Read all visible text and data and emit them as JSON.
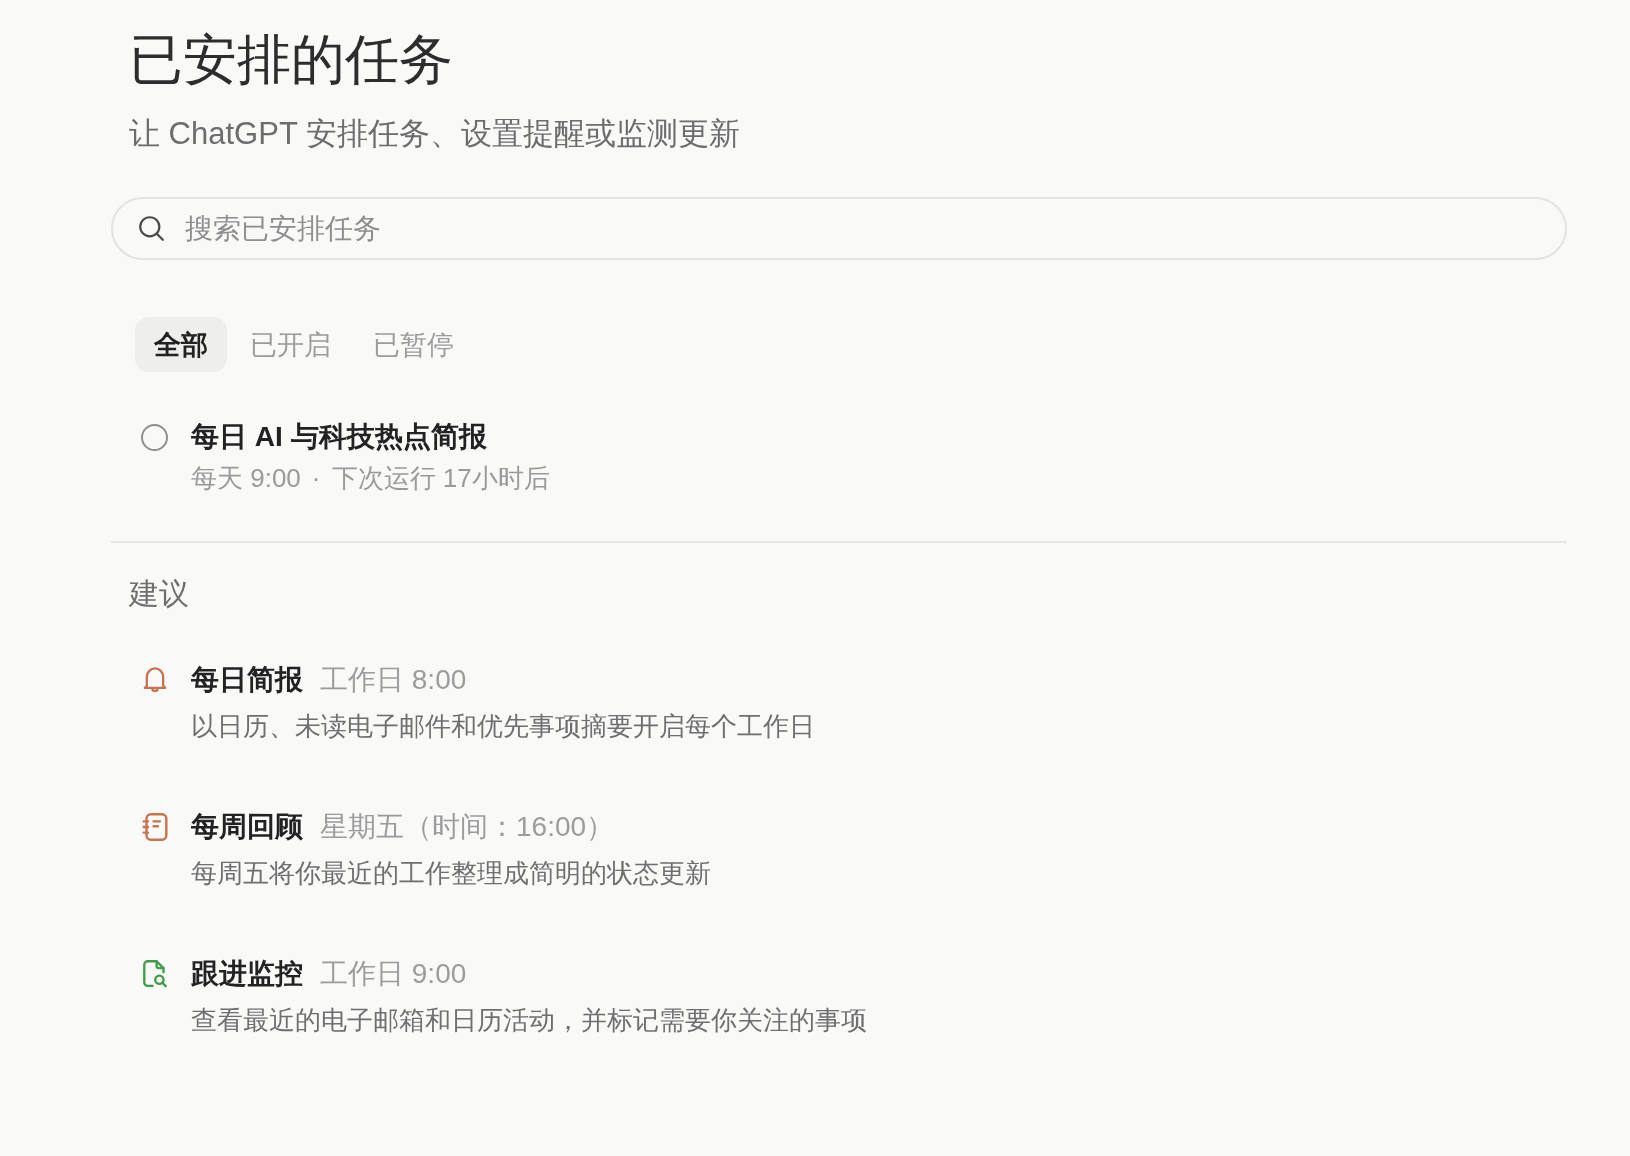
{
  "header": {
    "title": "已安排的任务",
    "subtitle": "让 ChatGPT 安排任务、设置提醒或监测更新"
  },
  "search": {
    "placeholder": "搜索已安排任务"
  },
  "tabs": [
    {
      "label": "全部",
      "selected": true
    },
    {
      "label": "已开启",
      "selected": false
    },
    {
      "label": "已暂停",
      "selected": false
    }
  ],
  "tasks": [
    {
      "title": "每日 AI 与科技热点简报",
      "schedule": "每天 9:00",
      "separator": "·",
      "next_run": "下次运行 17小时后"
    }
  ],
  "suggestions": {
    "heading": "建议",
    "items": [
      {
        "kind": "bell",
        "color": "#c6744f",
        "title": "每日简报",
        "schedule": "工作日 8:00",
        "description": "以日历、未读电子邮件和优先事项摘要开启每个工作日"
      },
      {
        "kind": "notebook",
        "color": "#c6744f",
        "title": "每周回顾",
        "schedule": "星期五（时间：16:00）",
        "description": "每周五将你最近的工作整理成简明的状态更新"
      },
      {
        "kind": "file-search",
        "color": "#3e9c4c",
        "title": "跟进监控",
        "schedule": "工作日 9:00",
        "description": "查看最近的电子邮箱和日历活动，并标记需要你关注的事项"
      }
    ]
  }
}
